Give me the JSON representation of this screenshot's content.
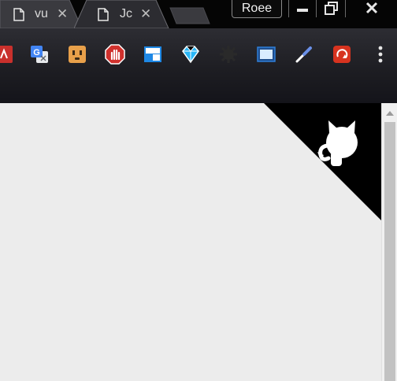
{
  "tabs": [
    {
      "title": "vu",
      "close": "✕",
      "active": false
    },
    {
      "title": "Jc",
      "close": "✕",
      "active": true
    }
  ],
  "profile": {
    "name": "Roee"
  },
  "window_controls": [
    "minimize",
    "restore",
    "close"
  ],
  "extensions": [
    {
      "name": "pdf-extension-icon",
      "color": "#c9302c"
    },
    {
      "name": "google-translate-icon",
      "color": "#4285f4"
    },
    {
      "name": "outlet-face-icon",
      "color": "#e8a04a"
    },
    {
      "name": "adblock-stop-icon",
      "color": "#d0312d"
    },
    {
      "name": "window-app-icon",
      "color": "#1e88e5"
    },
    {
      "name": "diamond-gem-icon",
      "color": "#29b6f6"
    },
    {
      "name": "puzzle-gear-icon",
      "color": "#2a2a2a"
    },
    {
      "name": "screen-capture-icon",
      "color": "#2f7fd8"
    },
    {
      "name": "color-picker-icon",
      "color": "#6a8fe6"
    },
    {
      "name": "red-recycle-icon",
      "color": "#d7331f"
    }
  ],
  "corner_banner": {
    "icon": "github-octocat-icon",
    "background": "#000000",
    "foreground": "#ffffff"
  },
  "page": {
    "background": "#ececec"
  }
}
